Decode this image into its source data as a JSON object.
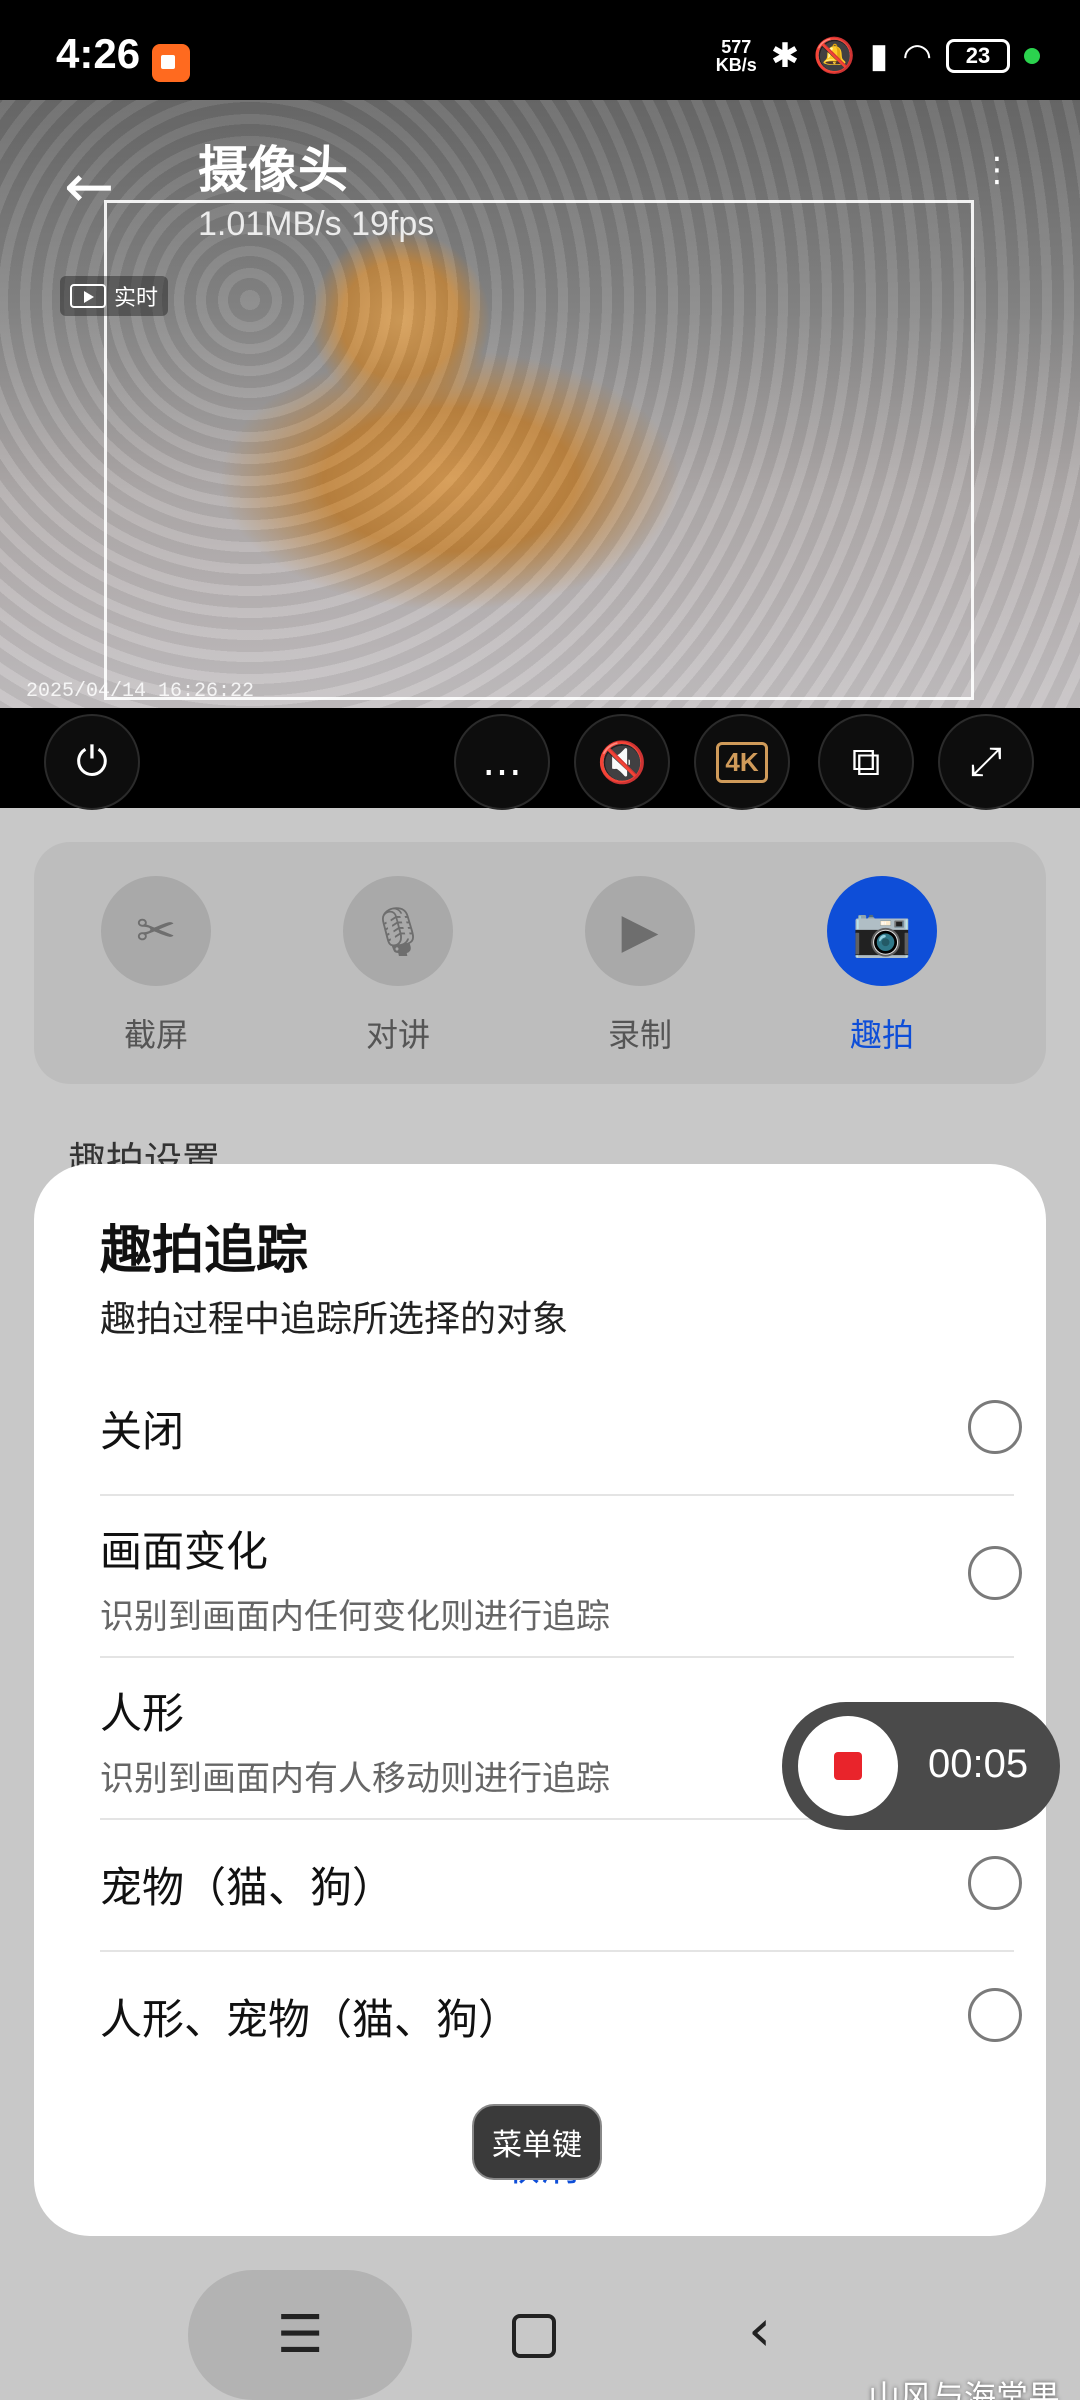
{
  "status_bar": {
    "time": "4:26",
    "net_speed_value": "577",
    "net_speed_unit": "KB/s",
    "battery": "23",
    "icons": [
      "bluetooth-icon",
      "silent-icon",
      "signal-icon",
      "wifi-icon"
    ]
  },
  "camera": {
    "title": "摄像头",
    "stats": "1.01MB/s  19fps",
    "live_label": "实时",
    "timestamp": "2025/04/14  16:26:22"
  },
  "controls": {
    "k4_label": "4K"
  },
  "functions": [
    {
      "label": "截屏",
      "icon": "scissors-icon"
    },
    {
      "label": "对讲",
      "icon": "microphone-icon"
    },
    {
      "label": "录制",
      "icon": "video-camera-icon"
    },
    {
      "label": "趣拍",
      "icon": "camera-icon",
      "active": true
    }
  ],
  "settings_peek": "趣拍设置",
  "dialog": {
    "title": "趣拍追踪",
    "subtitle": "趣拍过程中追踪所选择的对象",
    "options": [
      {
        "label": "关闭",
        "desc": ""
      },
      {
        "label": "画面变化",
        "desc": "识别到画面内任何变化则进行追踪"
      },
      {
        "label": "人形",
        "desc": "识别到画面内有人移动则进行追踪"
      },
      {
        "label": "宠物（猫、狗）",
        "desc": ""
      },
      {
        "label": "人形、宠物（猫、狗）",
        "desc": ""
      }
    ],
    "cancel_label": "取消",
    "tooltip": "菜单键"
  },
  "recording": {
    "time": "00:05"
  },
  "watermark": "山风与海棠果",
  "colors": {
    "accent": "#0e4ed8",
    "record_red": "#e9242b",
    "k4_gold": "#d09b5a"
  }
}
